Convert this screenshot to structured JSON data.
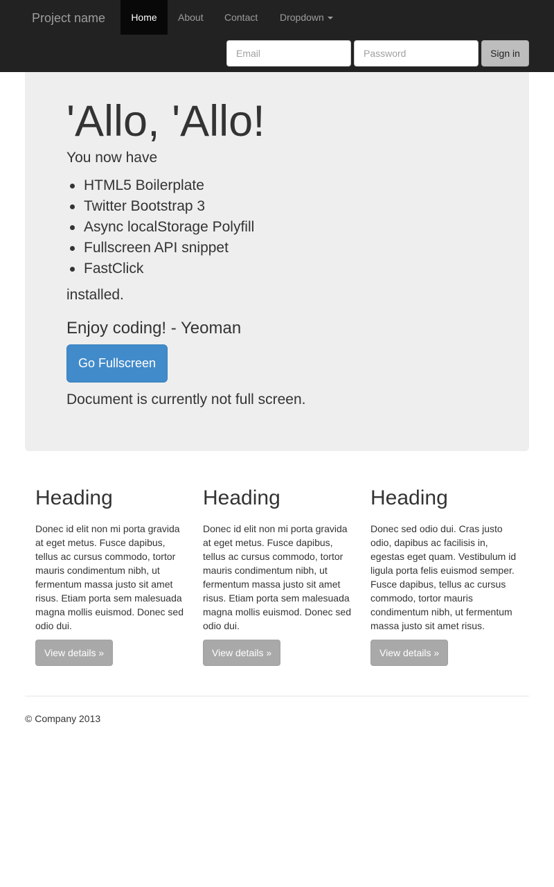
{
  "navbar": {
    "brand": "Project name",
    "items": [
      {
        "label": "Home",
        "active": true
      },
      {
        "label": "About",
        "active": false
      },
      {
        "label": "Contact",
        "active": false
      },
      {
        "label": "Dropdown",
        "active": false
      }
    ],
    "signin_form": {
      "email_placeholder": "Email",
      "password_placeholder": "Password",
      "email_value": "",
      "password_value": "",
      "submit_label": "Sign in"
    }
  },
  "jumbotron": {
    "title": "'Allo, 'Allo!",
    "lead": "You now have",
    "features": [
      "HTML5 Boilerplate",
      "Twitter Bootstrap 3",
      "Async localStorage Polyfill",
      "Fullscreen API snippet",
      "FastClick"
    ],
    "installed": "installed.",
    "enjoy": "Enjoy coding! - Yeoman",
    "button_label": "Go Fullscreen",
    "status": "Document is currently not full screen."
  },
  "columns": [
    {
      "heading": "Heading",
      "text": "Donec id elit non mi porta gravida at eget metus. Fusce dapibus, tellus ac cursus commodo, tortor mauris condimentum nibh, ut fermentum massa justo sit amet risus. Etiam porta sem malesuada magna mollis euismod. Donec sed odio dui.",
      "button_label": "View details »"
    },
    {
      "heading": "Heading",
      "text": "Donec id elit non mi porta gravida at eget metus. Fusce dapibus, tellus ac cursus commodo, tortor mauris condimentum nibh, ut fermentum massa justo sit amet risus. Etiam porta sem malesuada magna mollis euismod. Donec sed odio dui.",
      "button_label": "View details »"
    },
    {
      "heading": "Heading",
      "text": "Donec sed odio dui. Cras justo odio, dapibus ac facilisis in, egestas eget quam. Vestibulum id ligula porta felis euismod semper. Fusce dapibus, tellus ac cursus commodo, tortor mauris condimentum nibh, ut fermentum massa justo sit amet risus.",
      "button_label": "View details »"
    }
  ],
  "footer": {
    "text": "© Company 2013"
  },
  "colors": {
    "navbar_bg": "#222222",
    "nav_active_bg": "#080808",
    "jumbotron_bg": "#eeeeee",
    "primary_button": "#428bca",
    "details_button": "#a9a9a9"
  },
  "icons": {
    "dropdown": "caret-down-icon",
    "list_bullet": "bullet-icon"
  }
}
